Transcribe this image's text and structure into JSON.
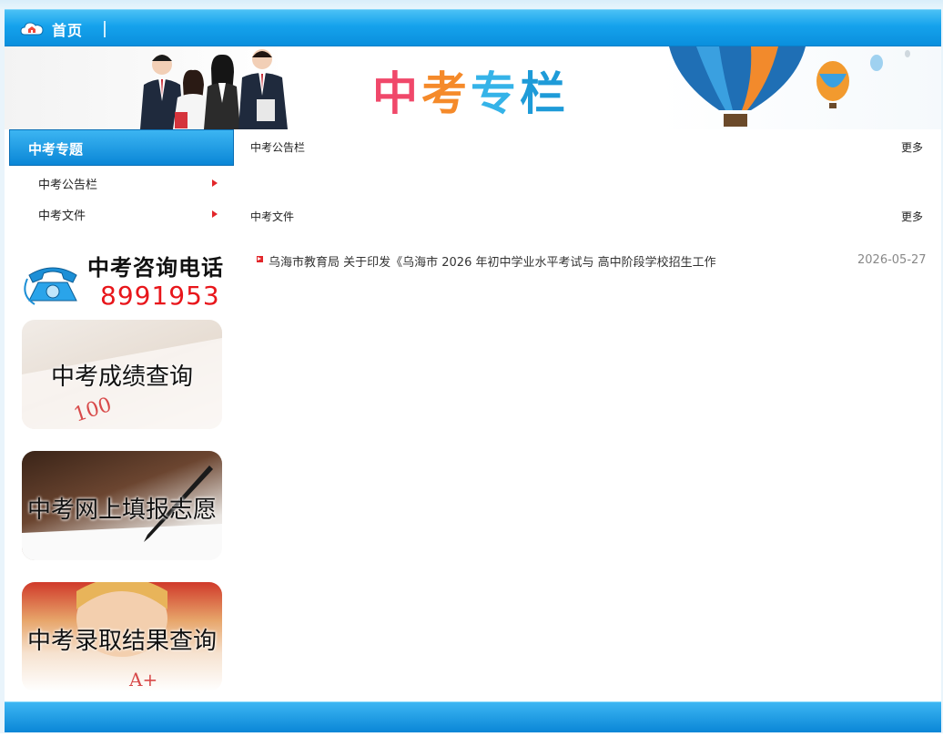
{
  "nav": {
    "home_label": "首页"
  },
  "banner": {
    "title_chars": [
      "中",
      "考",
      "专",
      "栏"
    ]
  },
  "sidebar": {
    "heading": "中考专题",
    "items": [
      {
        "label": "中考公告栏"
      },
      {
        "label": "中考文件"
      }
    ],
    "phone": {
      "title": "中考咨询电话",
      "number": "8991953"
    },
    "cards": [
      {
        "label": "中考成绩查询"
      },
      {
        "label": "中考网上填报志愿"
      },
      {
        "label": "中考录取结果查询"
      }
    ]
  },
  "main": {
    "sections": [
      {
        "title": "中考公告栏",
        "more": "更多"
      },
      {
        "title": "中考文件",
        "more": "更多"
      }
    ],
    "news": [
      {
        "title": "乌海市教育局 关于印发《乌海市 2026 年初中学业水平考试与 高中阶段学校招生工作",
        "date": "2026-05-27"
      }
    ]
  },
  "colors": {
    "accent": "#0a8fdd",
    "arrow": "#e2262a",
    "phone_number": "#e8161b"
  }
}
